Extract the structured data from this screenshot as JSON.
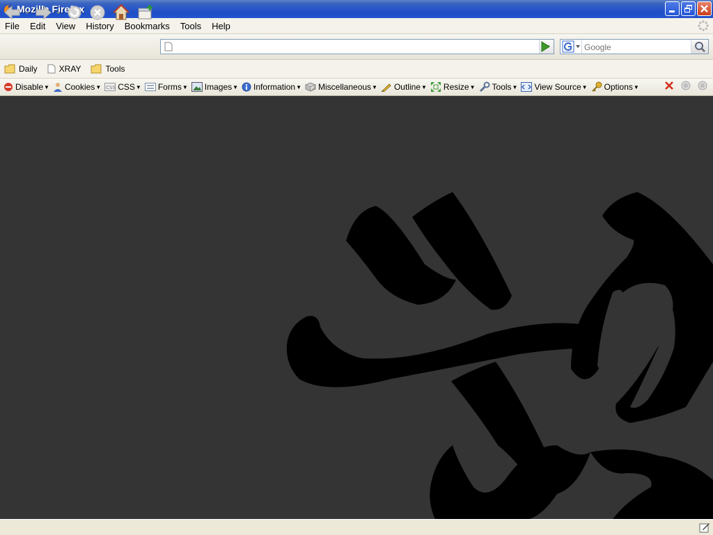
{
  "window": {
    "title": "Mozilla Firefox"
  },
  "menu": [
    "File",
    "Edit",
    "View",
    "History",
    "Bookmarks",
    "Tools",
    "Help"
  ],
  "nav": {
    "url_value": "",
    "search_placeholder": "Google"
  },
  "bookmarks": [
    {
      "label": "Daily",
      "icon": "folder-icon"
    },
    {
      "label": "XRAY",
      "icon": "page-icon"
    },
    {
      "label": "Tools",
      "icon": "folder-icon"
    }
  ],
  "devbar": [
    {
      "label": "Disable",
      "icon": "disable-icon"
    },
    {
      "label": "Cookies",
      "icon": "cookies-icon"
    },
    {
      "label": "CSS",
      "icon": "css-icon"
    },
    {
      "label": "Forms",
      "icon": "forms-icon"
    },
    {
      "label": "Images",
      "icon": "images-icon"
    },
    {
      "label": "Information",
      "icon": "info-icon"
    },
    {
      "label": "Miscellaneous",
      "icon": "misc-icon"
    },
    {
      "label": "Outline",
      "icon": "outline-icon"
    },
    {
      "label": "Resize",
      "icon": "resize-icon"
    },
    {
      "label": "Tools",
      "icon": "tools-icon"
    },
    {
      "label": "View Source",
      "icon": "view-source-icon"
    },
    {
      "label": "Options",
      "icon": "options-icon"
    }
  ],
  "colors": {
    "content_bg": "#343434",
    "artwork": "#000000",
    "titlebar": "#2454cf"
  }
}
